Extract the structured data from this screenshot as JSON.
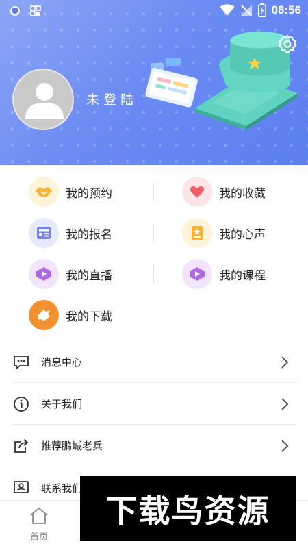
{
  "status_bar": {
    "time": "08:56"
  },
  "profile": {
    "login_text": "未登陆"
  },
  "features": [
    {
      "label": "我的预约",
      "icon": "handshake-icon",
      "bg": "#fdf3d8",
      "color": "#f5b530"
    },
    {
      "label": "我的收藏",
      "icon": "heart-icon",
      "bg": "#fde5e7",
      "color": "#ef5f67"
    },
    {
      "label": "我的报名",
      "icon": "form-icon",
      "bg": "#e6e9fb",
      "color": "#7183e8"
    },
    {
      "label": "我的心声",
      "icon": "note-icon",
      "bg": "#fdf3d8",
      "color": "#f5b530"
    },
    {
      "label": "我的直播",
      "icon": "live-icon",
      "bg": "#f2e5fb",
      "color": "#b06be3"
    },
    {
      "label": "我的课程",
      "icon": "course-icon",
      "bg": "#f2e5fb",
      "color": "#b06be3"
    },
    {
      "label": "我的下载",
      "icon": "download-icon",
      "bg": "#f3902f",
      "color": "#ffffff"
    }
  ],
  "menu": [
    {
      "label": "消息中心",
      "icon": "message-icon"
    },
    {
      "label": "关于我们",
      "icon": "info-icon"
    },
    {
      "label": "推荐鹏城老兵",
      "icon": "share-icon"
    },
    {
      "label": "联系我们",
      "icon": "contact-icon"
    }
  ],
  "bottom_nav": {
    "home_label": "首页"
  },
  "watermark": "下载鸟资源"
}
